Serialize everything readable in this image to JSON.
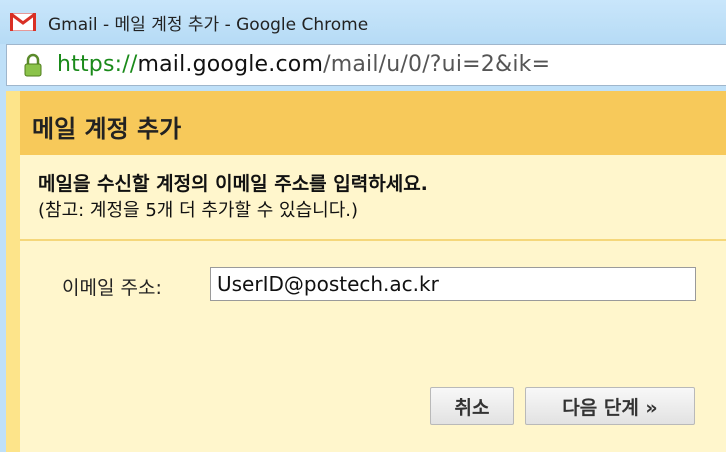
{
  "window": {
    "title": "Gmail - 메일 계정 추가 - Google Chrome"
  },
  "address_bar": {
    "url_protocol": "https://",
    "url_host": "mail.google.com",
    "url_path": "/mail/u/0/?ui=2&ik="
  },
  "dialog": {
    "title": "메일 계정 추가",
    "instruction": "메일을 수신할 계정의 이메일 주소를 입력하세요.",
    "note": "(참고: 계정을 5개 더 추가할 수 있습니다.)",
    "email_label": "이메일 주소:",
    "email_value": "UserID@postech.ac.kr",
    "cancel_label": "취소",
    "next_label": "다음 단계 »"
  },
  "colors": {
    "header": "#f7c95a",
    "body": "#fff6cc",
    "url_protocol": "#1a8a1a",
    "titlebar": "#bfe0f8"
  },
  "icons": {
    "window_icon": "gmail-icon",
    "secure": "lock-icon"
  }
}
